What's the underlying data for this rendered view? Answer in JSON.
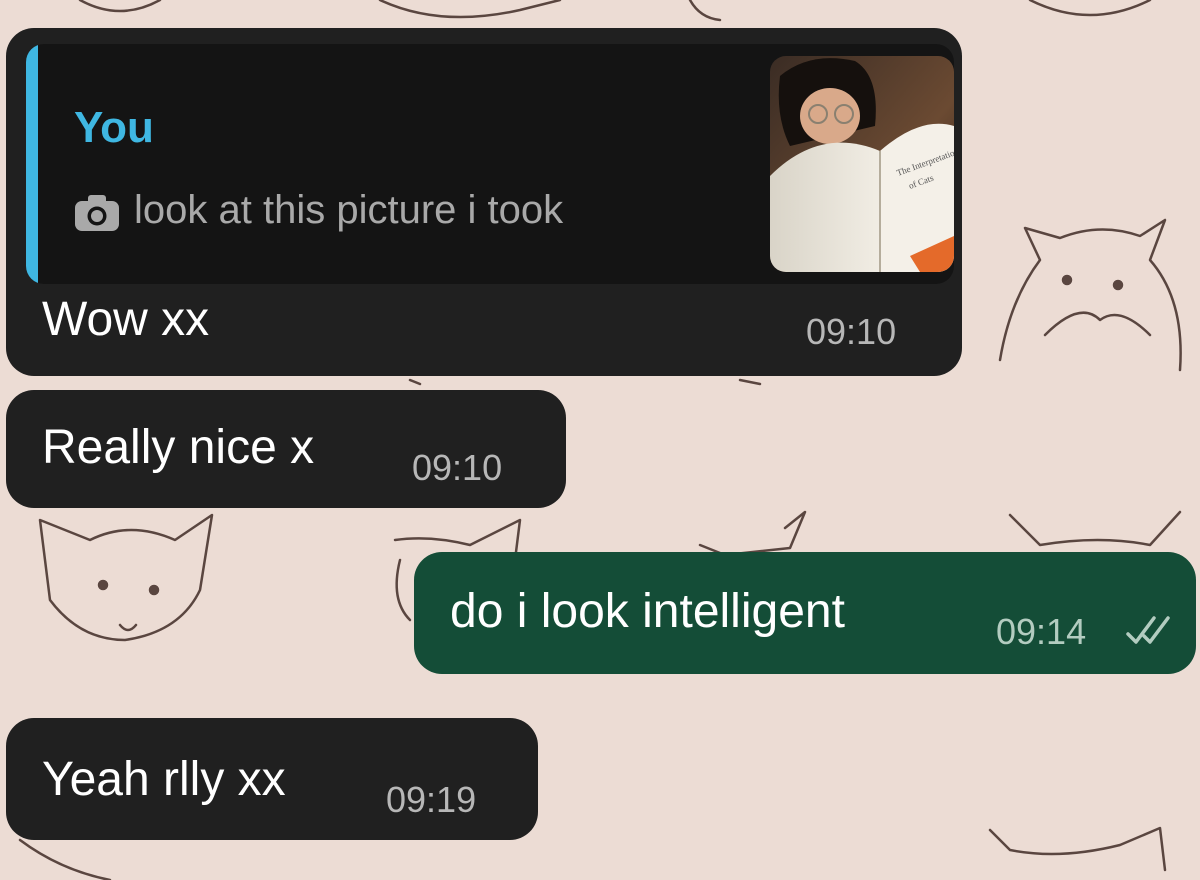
{
  "chat": {
    "messages": [
      {
        "direction": "incoming",
        "reply_to": {
          "author": "You",
          "icon": "camera-icon",
          "text": "look at this picture i took"
        },
        "text": "Wow xx",
        "time": "09:10"
      },
      {
        "direction": "incoming",
        "text": "Really nice x",
        "time": "09:10"
      },
      {
        "direction": "outgoing",
        "text": "do i look intelligent",
        "time": "09:14",
        "status_icon": "double-check-icon"
      },
      {
        "direction": "incoming",
        "text": "Yeah rlly xx",
        "time": "09:19"
      }
    ]
  },
  "colors": {
    "wallpaper": "#ecdcd4",
    "incoming_bubble": "#202020",
    "outgoing_bubble": "#144d37",
    "reply_accent": "#3fb7e2"
  }
}
